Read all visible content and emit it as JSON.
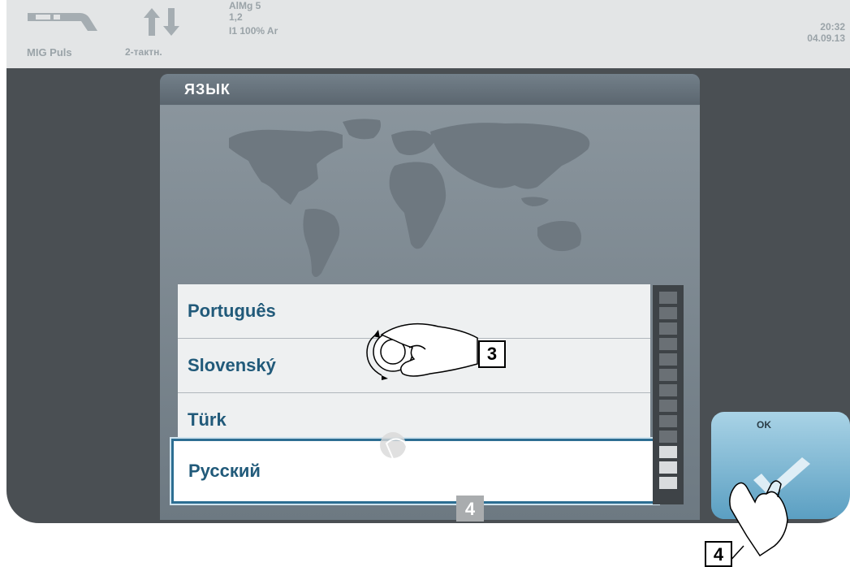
{
  "status_bar": {
    "process_mode": "MIG Puls",
    "trigger_mode": "2-тактн.",
    "material_lines": [
      "AlMg 5",
      "1,2",
      "I1 100% Ar"
    ],
    "time": "20:32",
    "date": "04.09.13",
    "icons": [
      "welding-torch-icon",
      "trigger-mode-arrows-icon"
    ]
  },
  "dialog": {
    "title": "ЯЗЫК",
    "map_icon": "world-map-icon"
  },
  "language_list": {
    "items": [
      "Português",
      "Slovenský",
      "Türk"
    ],
    "selected": "Русский"
  },
  "ok_button": {
    "label": "OK",
    "icon": "checkmark-icon"
  },
  "annotations": {
    "knob_step": "3",
    "touch_step_list": "4",
    "touch_step_ok": "4"
  },
  "colors": {
    "accent": "#2d6e92",
    "list_text": "#215a7a",
    "frame": "#4a4f53",
    "ok_button": "#7fb8d4"
  }
}
